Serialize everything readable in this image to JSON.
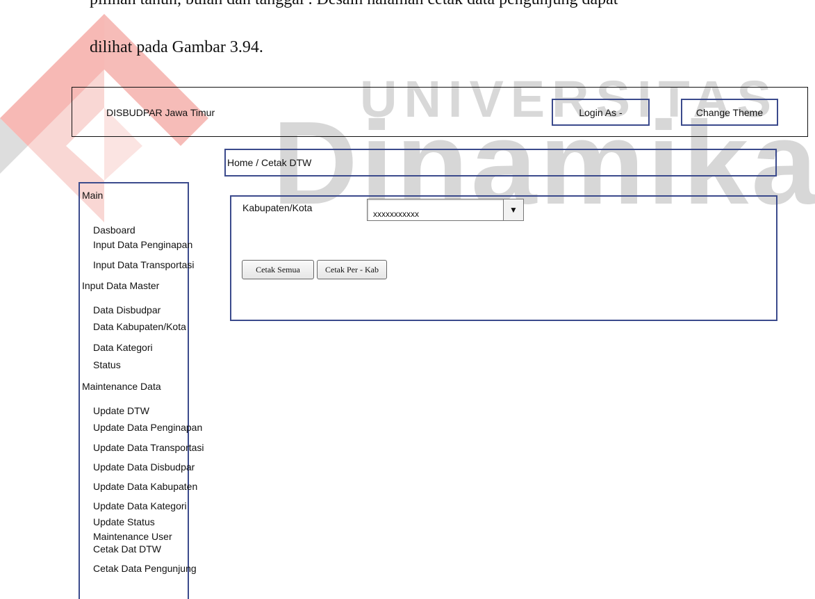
{
  "document": {
    "line1": "pilihan tahun, bulan dan tanggal . Desain halaman cetak data pengunjung dapat",
    "line2": "dilihat pada Gambar 3.94."
  },
  "watermark": {
    "top": "UNIVERSITAS",
    "main": "Dinamika"
  },
  "header": {
    "brand": "DISBUDPAR Jawa Timur",
    "login_label": "Login As -",
    "theme_label": "Change Theme"
  },
  "breadcrumb": "Home / Cetak DTW",
  "sidebar": {
    "items": [
      {
        "label": "Main"
      },
      {
        "label": "Dasboard"
      },
      {
        "label": "Input Data Penginapan"
      },
      {
        "label": "Input Data Transportasi"
      },
      {
        "label": "Input Data Master"
      },
      {
        "label": "Data Disbudpar"
      },
      {
        "label": "Data Kabupaten/Kota"
      },
      {
        "label": "Data Kategori"
      },
      {
        "label": "Status"
      },
      {
        "label": "Maintenance Data"
      },
      {
        "label": "Update DTW"
      },
      {
        "label": "Update Data Penginapan"
      },
      {
        "label": "Update Data Transportasi"
      },
      {
        "label": "Update Data Disbudpar"
      },
      {
        "label": "Update Data Kabupaten"
      },
      {
        "label": "Update Data Kategori"
      },
      {
        "label": "Update Status"
      },
      {
        "label": "Maintenance User"
      },
      {
        "label": "Cetak Dat DTW"
      },
      {
        "label": "Cetak Data Pengunjung"
      }
    ]
  },
  "form": {
    "kabupaten_label": "Kabupaten/Kota",
    "kabupaten_value": "xxxxxxxxxxx",
    "cetak_semua_label": "Cetak Semua",
    "cetak_per_kab_label": "Cetak Per - Kab"
  },
  "colors": {
    "border_accent": "#3b4a8c",
    "logo_red": "#e8423b"
  }
}
